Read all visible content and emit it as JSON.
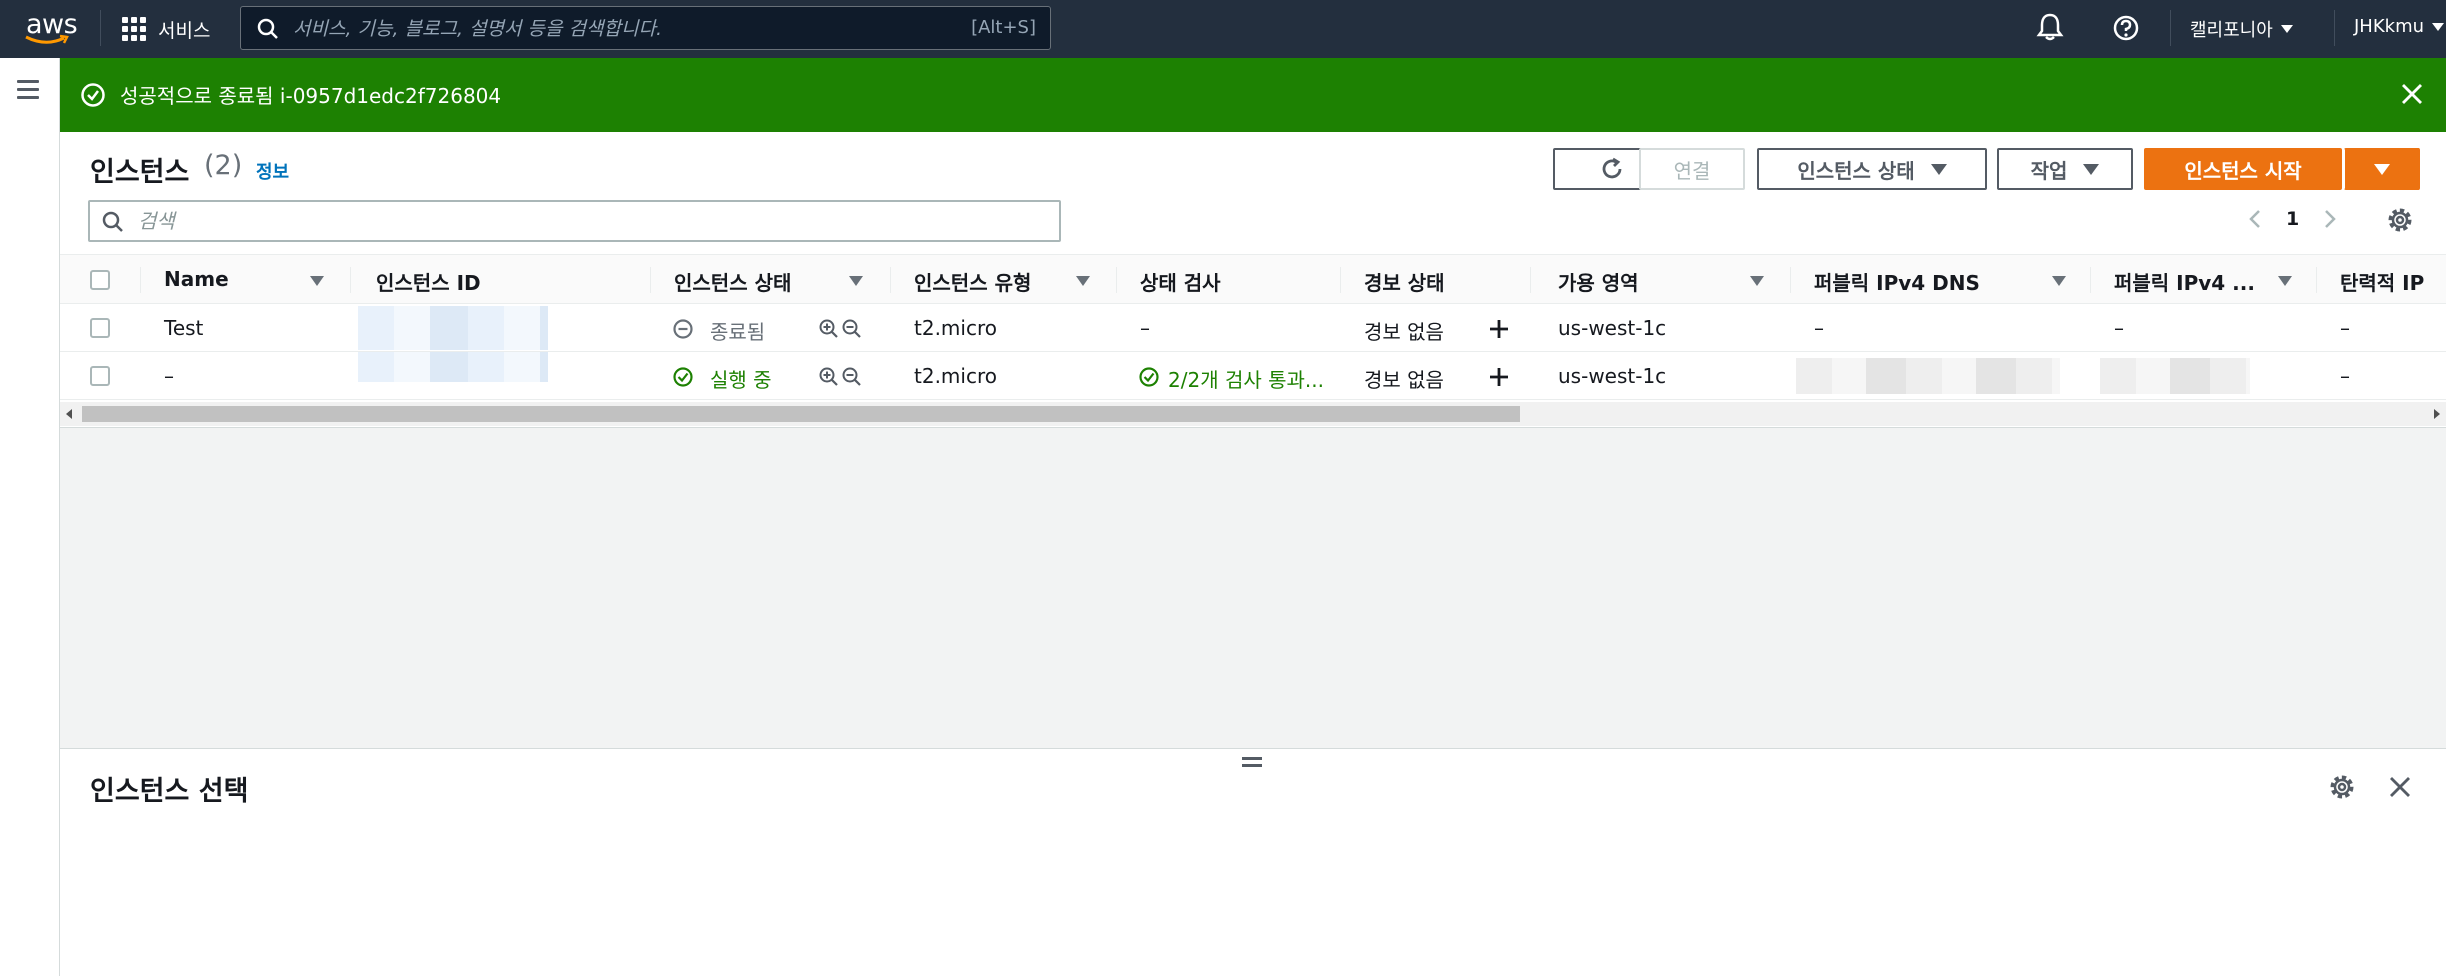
{
  "topbar": {
    "logo_text": "aws",
    "services_label": "서비스",
    "search_placeholder": "서비스, 기능, 블로그, 설명서 등을 검색합니다.",
    "search_shortcut": "[Alt+S]",
    "region_label": "캘리포니아",
    "user_label": "JHKkmu"
  },
  "flash": {
    "message": "성공적으로 종료됨 i-0957d1edc2f726804",
    "color": "#1d8102"
  },
  "instances_panel": {
    "title": "인스턴스",
    "count": "(2)",
    "info_link": "정보",
    "connect_label": "연결",
    "instance_state_label": "인스턴스 상태",
    "actions_label": "작업",
    "launch_label": "인스턴스 시작",
    "search_placeholder": "검색",
    "page_number": "1",
    "accent_color": "#ec7211"
  },
  "table": {
    "columns": [
      "Name",
      "인스턴스 ID",
      "인스턴스 상태",
      "인스턴스 유형",
      "상태 검사",
      "경보 상태",
      "가용 영역",
      "퍼블릭 IPv4 DNS",
      "퍼블릭 IPv4 ...",
      "탄력적 IP"
    ],
    "rows": [
      {
        "name": "Test",
        "state": "종료됨",
        "type": "t2.micro",
        "status_check": "–",
        "alarm": "경보 없음",
        "az": "us-west-1c",
        "dns": "–",
        "ipv4": "–",
        "eip": "–"
      },
      {
        "name": "–",
        "state": "실행 중",
        "type": "t2.micro",
        "status_check": "2/2개 검사 통과...",
        "alarm": "경보 없음",
        "az": "us-west-1c",
        "eip": "–"
      }
    ]
  },
  "split_panel": {
    "title": "인스턴스 선택"
  }
}
